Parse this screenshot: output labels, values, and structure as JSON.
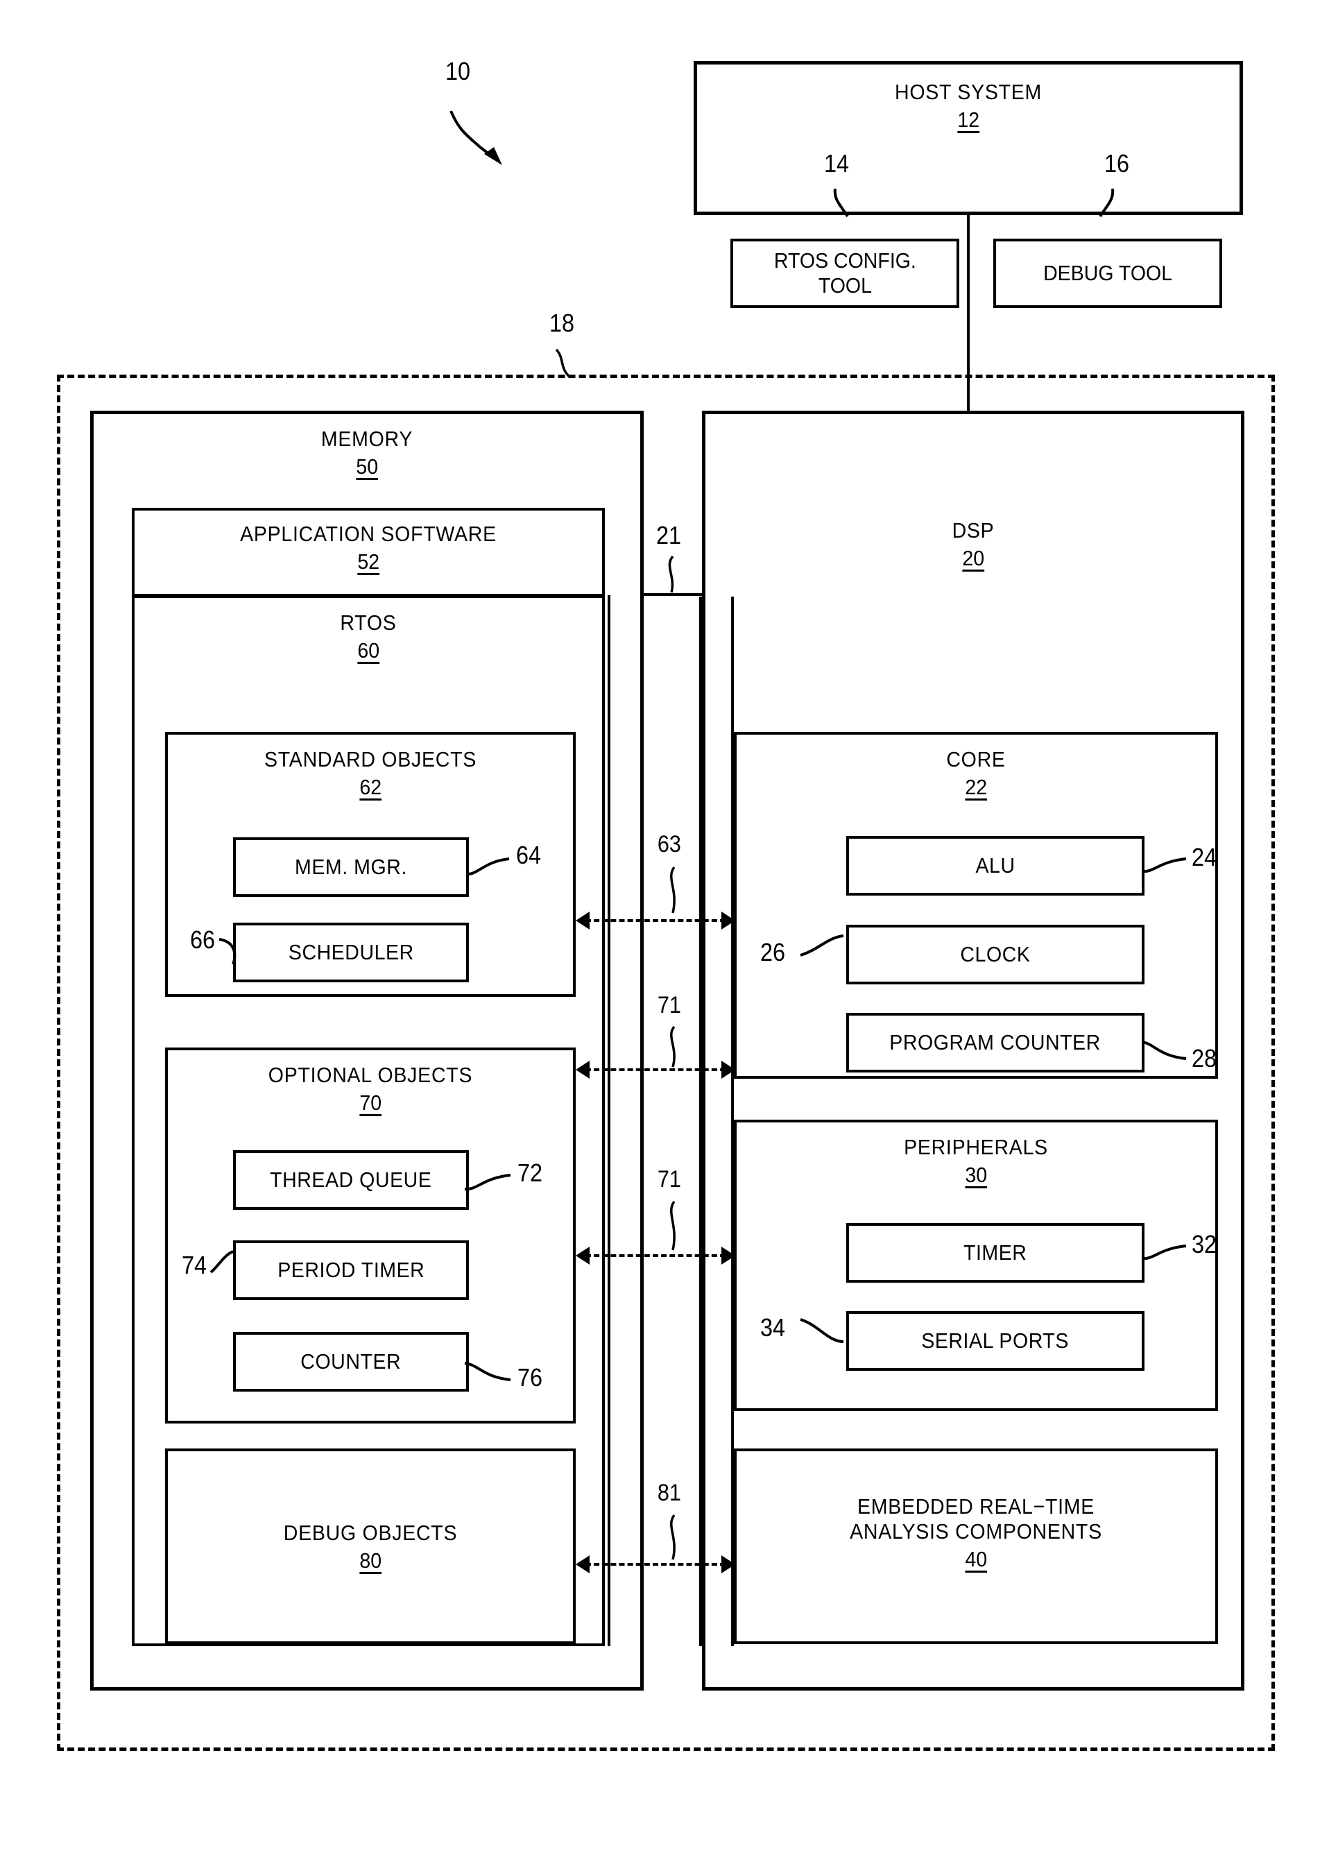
{
  "figure": {
    "ref_main": "10"
  },
  "host": {
    "title": "HOST SYSTEM",
    "num": "12",
    "tools": [
      {
        "label": "RTOS CONFIG.\nTOOL",
        "num": "14"
      },
      {
        "label": "DEBUG TOOL",
        "num": "16"
      }
    ]
  },
  "boundary": {
    "num": "18"
  },
  "memory": {
    "title": "MEMORY",
    "num": "50",
    "app_software": {
      "title": "APPLICATION SOFTWARE",
      "num": "52"
    },
    "rtos": {
      "title": "RTOS",
      "num": "60"
    },
    "standard_objects": {
      "title": "STANDARD OBJECTS",
      "num": "62",
      "items": [
        {
          "label": "MEM. MGR.",
          "num": "64"
        },
        {
          "label": "SCHEDULER",
          "num": "66"
        }
      ]
    },
    "optional_objects": {
      "title": "OPTIONAL OBJECTS",
      "num": "70",
      "items": [
        {
          "label": "THREAD QUEUE",
          "num": "72"
        },
        {
          "label": "PERIOD TIMER",
          "num": "74"
        },
        {
          "label": "COUNTER",
          "num": "76"
        }
      ]
    },
    "debug_objects": {
      "title": "DEBUG OBJECTS",
      "num": "80"
    }
  },
  "dsp": {
    "title": "DSP",
    "num": "20",
    "core": {
      "title": "CORE",
      "num": "22",
      "items": [
        {
          "label": "ALU",
          "num": "24"
        },
        {
          "label": "CLOCK",
          "num": "26"
        },
        {
          "label": "PROGRAM COUNTER",
          "num": "28"
        }
      ]
    },
    "peripherals": {
      "title": "PERIPHERALS",
      "num": "30",
      "items": [
        {
          "label": "TIMER",
          "num": "32"
        },
        {
          "label": "SERIAL PORTS",
          "num": "34"
        }
      ]
    },
    "analysis": {
      "title_line1": "EMBEDDED REAL−TIME",
      "title_line2": "ANALYSIS COMPONENTS",
      "num": "40"
    }
  },
  "buses": {
    "memory_dsp": "21",
    "core_std": "63",
    "opt_core": "71",
    "opt_periph": "71",
    "debug_analysis": "81"
  }
}
